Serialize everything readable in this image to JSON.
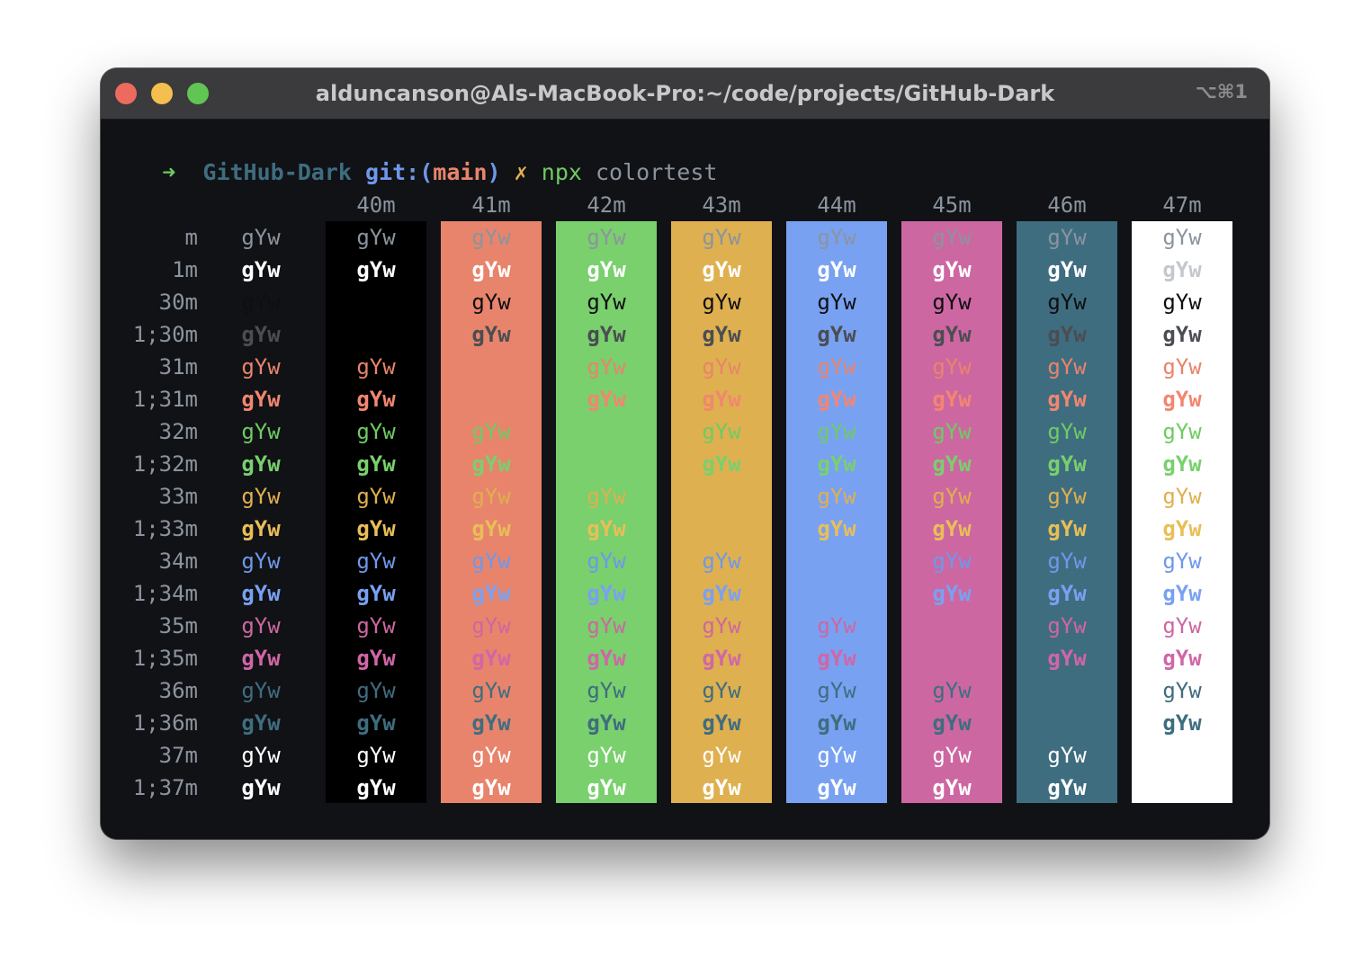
{
  "window": {
    "title": "alduncanson@Als-MacBook-Pro:~/code/projects/GitHub-Dark",
    "shortcut": "⌥⌘1",
    "traffic_lights": [
      "#ed6a5e",
      "#f5bf4f",
      "#61c554"
    ]
  },
  "prompt": {
    "arrow": "➜",
    "dir": "GitHub-Dark",
    "git_label": "git:(",
    "branch": "main",
    "git_close": ")",
    "dirty": "✗",
    "cmd": "npx",
    "args": "colortest"
  },
  "sample_text": "gYw",
  "bg_headers": [
    "40m",
    "41m",
    "42m",
    "43m",
    "44m",
    "45m",
    "46m",
    "47m"
  ],
  "row_labels": [
    "m",
    "1m",
    "30m",
    "1;30m",
    "31m",
    "1;31m",
    "32m",
    "1;32m",
    "33m",
    "1;33m",
    "34m",
    "1;34m",
    "35m",
    "1;35m",
    "36m",
    "1;36m",
    "37m",
    "1;37m"
  ],
  "colors": {
    "terminal_bg": "#111216",
    "default_fg": "#8b949e",
    "bright_white": "#ffffff",
    "bg": [
      "#000000",
      "#e8846c",
      "#79d06d",
      "#dfb04f",
      "#79a1f2",
      "#cd67a1",
      "#3f6d80",
      "#ffffff"
    ],
    "fg_normal": [
      "#0d0f12",
      "#e8846c",
      "#6ecb63",
      "#dfb04f",
      "#6f98ea",
      "#cd67a1",
      "#3f6d80",
      "#ffffff"
    ],
    "fg_bright": [
      "#4a4d52",
      "#f28670",
      "#79d06d",
      "#e8bf57",
      "#79a1f2",
      "#d066a7",
      "#3f6d80",
      "#ffffff"
    ],
    "prompt_arrow": "#6ecb63",
    "prompt_dir": "#3f6d80",
    "prompt_git": "#6f98ea",
    "prompt_branch": "#e8846c",
    "prompt_dirty": "#dfb04f",
    "prompt_cmd": "#6ecb63",
    "prompt_args": "#8b949e"
  },
  "mode1_fg_default": "#ffffff",
  "mode1_on_white": "#c4c8cd"
}
